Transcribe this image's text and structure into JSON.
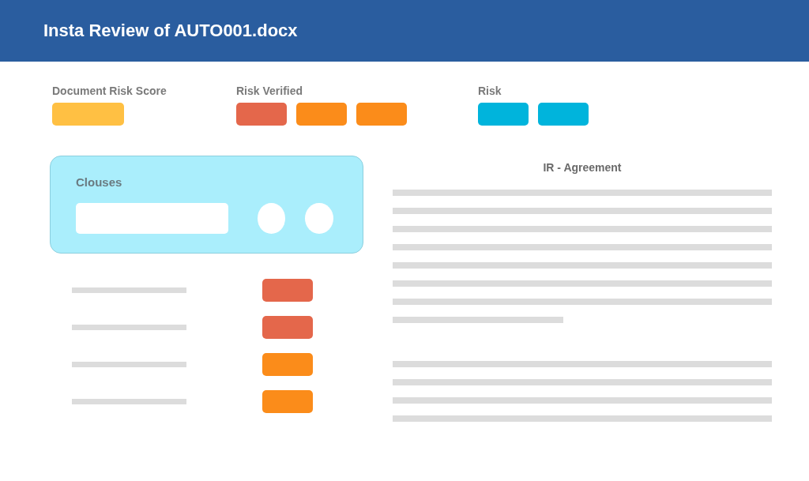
{
  "header": {
    "title": "Insta Review of AUTO001.docx"
  },
  "score_groups": [
    {
      "label": "Document Risk Score",
      "badges": [
        {
          "color": "#ffc043"
        }
      ]
    },
    {
      "label": "Risk Verified",
      "badges": [
        {
          "color": "#e4674b"
        },
        {
          "color": "#fb8c1a"
        },
        {
          "color": "#fb8c1a"
        }
      ]
    },
    {
      "label": "Risk",
      "badges": [
        {
          "color": "#00b4dc"
        },
        {
          "color": "#00b4dc"
        }
      ]
    }
  ],
  "clauses_panel": {
    "title": "Clouses"
  },
  "clause_rows": [
    {
      "color": "#e4674b"
    },
    {
      "color": "#e4674b"
    },
    {
      "color": "#fb8c1a"
    },
    {
      "color": "#fb8c1a"
    }
  ],
  "document": {
    "title": "IR - Agreement"
  }
}
